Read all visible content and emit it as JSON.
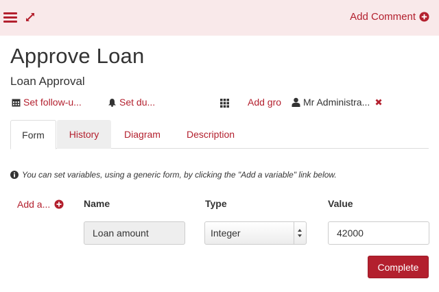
{
  "header": {
    "add_comment_label": "Add Comment",
    "icons": [
      "menu-icon",
      "expand-icon",
      "plus-circle-icon"
    ]
  },
  "task": {
    "title": "Approve Loan",
    "subtitle": "Loan Approval"
  },
  "meta": {
    "follow_up_label": "Set follow-u...",
    "due_label": "Set du...",
    "add_group_label": "Add gro",
    "assignee": "Mr Administra..."
  },
  "tabs": [
    {
      "label": "Form",
      "active": true
    },
    {
      "label": "History",
      "active": false
    },
    {
      "label": "Diagram",
      "active": false
    },
    {
      "label": "Description",
      "active": false
    }
  ],
  "form": {
    "info_text": "You can set variables, using a generic form, by clicking the \"Add a variable\" link below.",
    "add_variable_label": "Add a...",
    "columns": {
      "name": "Name",
      "type": "Type",
      "value": "Value"
    },
    "variable": {
      "name": "Loan amount",
      "type": "Integer",
      "value": "42000"
    },
    "complete_label": "Complete"
  },
  "colors": {
    "accent": "#b3202e",
    "topbar_bg": "#f9e9ea",
    "text": "#333333"
  }
}
